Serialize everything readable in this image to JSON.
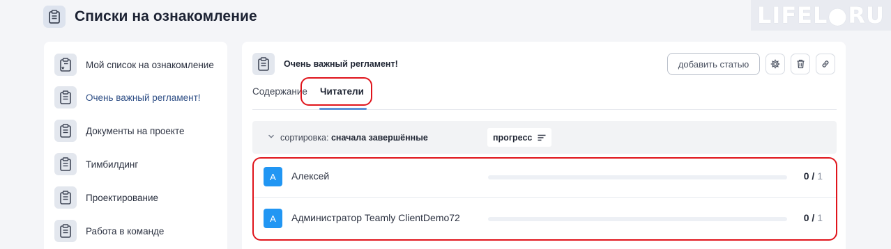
{
  "page": {
    "title": "Списки на ознакомление",
    "watermark": "LIFEL●RU"
  },
  "sidebar": {
    "items": [
      {
        "label": "Мой список на ознакомление",
        "active": false
      },
      {
        "label": "Очень важный регламент!",
        "active": true
      },
      {
        "label": "Документы на проекте",
        "active": false
      },
      {
        "label": "Тимбилдинг",
        "active": false
      },
      {
        "label": "Проектирование",
        "active": false
      },
      {
        "label": "Работа в команде",
        "active": false
      }
    ]
  },
  "document": {
    "title": "Очень важный регламент!",
    "add_button": "добавить статью"
  },
  "tabs": {
    "contents": "Содержание",
    "readers": "Читатели",
    "active": "readers"
  },
  "sort": {
    "prefix": "сортировка:",
    "value": "сначала завершённые",
    "progress_label": "прогресс"
  },
  "readers": [
    {
      "avatar": "А",
      "name": "Алексей",
      "done": "0 /",
      "total": "1",
      "progress": 0
    },
    {
      "avatar": "А",
      "name": "Администратор Teamly ClientDemo72",
      "done": "0 /",
      "total": "1",
      "progress": 0
    }
  ],
  "colors": {
    "accent": "#2196f3",
    "highlight": "#e0141b",
    "tab_underline": "#5e93d8"
  }
}
